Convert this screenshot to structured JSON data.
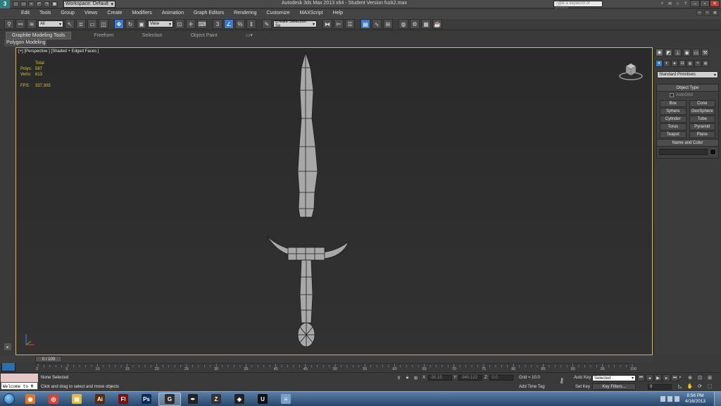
{
  "app": {
    "logo": "3",
    "workspace_label": "Workspace: Default",
    "title": "Autodesk 3ds Max 2013 x64 - Student Version    fuck2.max",
    "search_placeholder": "Type a keyword or phrase"
  },
  "menu": [
    "Edit",
    "Tools",
    "Group",
    "Views",
    "Create",
    "Modifiers",
    "Animation",
    "Graph Editors",
    "Rendering",
    "Customize",
    "MAXScript",
    "Help"
  ],
  "toolbar": {
    "selection_filter": "All",
    "reference_coord": "View",
    "named_selection_placeholder": "Create Selection Se"
  },
  "ribbon": {
    "tabs": [
      "Graphite Modeling Tools",
      "Freeform",
      "Selection",
      "Object Paint"
    ],
    "active_tab": "Graphite Modeling Tools",
    "panel": "Polygon Modeling"
  },
  "viewport": {
    "label": "[+] [Perspective ] [Shaded + Edged Faces ]",
    "stats_header": "Total",
    "polys_label": "Polys:",
    "polys_value": "587",
    "verts_label": "Verts:",
    "verts_value": "613",
    "fps_label": "FPS:",
    "fps_value": "337.305"
  },
  "command_panel": {
    "primitive_type": "Standard Primitives",
    "object_type_title": "Object Type",
    "autogrid_label": "AutoGrid",
    "object_buttons": [
      "Box",
      "Cone",
      "Sphere",
      "GeoSphere",
      "Cylinder",
      "Tube",
      "Torus",
      "Pyramid",
      "Teapot",
      "Plane"
    ],
    "name_color_title": "Name and Color"
  },
  "timeline": {
    "thumb_label": "0 / 100",
    "tick_labels": [
      "0",
      "5",
      "10",
      "15",
      "20",
      "25",
      "30",
      "35",
      "40",
      "45",
      "50",
      "55",
      "60",
      "65",
      "70",
      "75",
      "80",
      "85",
      "90",
      "95",
      "100"
    ]
  },
  "status": {
    "listener_text": "Welcome to M",
    "selection_status": "None Selected",
    "prompt": "Click and drag to select and move objects",
    "x_label": "X:",
    "x_value": "-35.15",
    "y_label": "Y:",
    "y_value": "-940.122",
    "z_label": "Z:",
    "z_value": "0.0",
    "grid": "Grid = 10.0",
    "add_time_tag": "Add Time Tag",
    "auto_key": "Auto Key",
    "set_key": "Set Key",
    "key_mode": "Selected",
    "key_filters": "Key Filters...",
    "current_frame": "0"
  },
  "taskbar": {
    "clock_time": "8:56 PM",
    "clock_date": "4/16/2013",
    "apps": [
      {
        "icon": "firefox-icon",
        "glyph": "◉",
        "color": "#e0762a"
      },
      {
        "icon": "chrome-icon",
        "glyph": "◎",
        "color": "#d4453b"
      },
      {
        "icon": "explorer-icon",
        "glyph": "▤",
        "color": "#e3b948"
      },
      {
        "icon": "illustrator-icon",
        "glyph": "Ai",
        "color": "#5a2a0a"
      },
      {
        "icon": "flash-icon",
        "glyph": "Fl",
        "color": "#7a1010"
      },
      {
        "icon": "photoshop-icon",
        "glyph": "Ps",
        "color": "#0a2a5a"
      },
      {
        "icon": "3dsmax-icon",
        "glyph": "G",
        "color": "#2d2d2d"
      },
      {
        "icon": "inkscape-icon",
        "glyph": "✒",
        "color": "#222"
      },
      {
        "icon": "zbrush-icon",
        "glyph": "Z",
        "color": "#333"
      },
      {
        "icon": "unity-icon",
        "glyph": "◈",
        "color": "#222"
      },
      {
        "icon": "udk-icon",
        "glyph": "U",
        "color": "#111"
      },
      {
        "icon": "notepad-icon",
        "glyph": "≡",
        "color": "#7aa0c8"
      }
    ]
  }
}
